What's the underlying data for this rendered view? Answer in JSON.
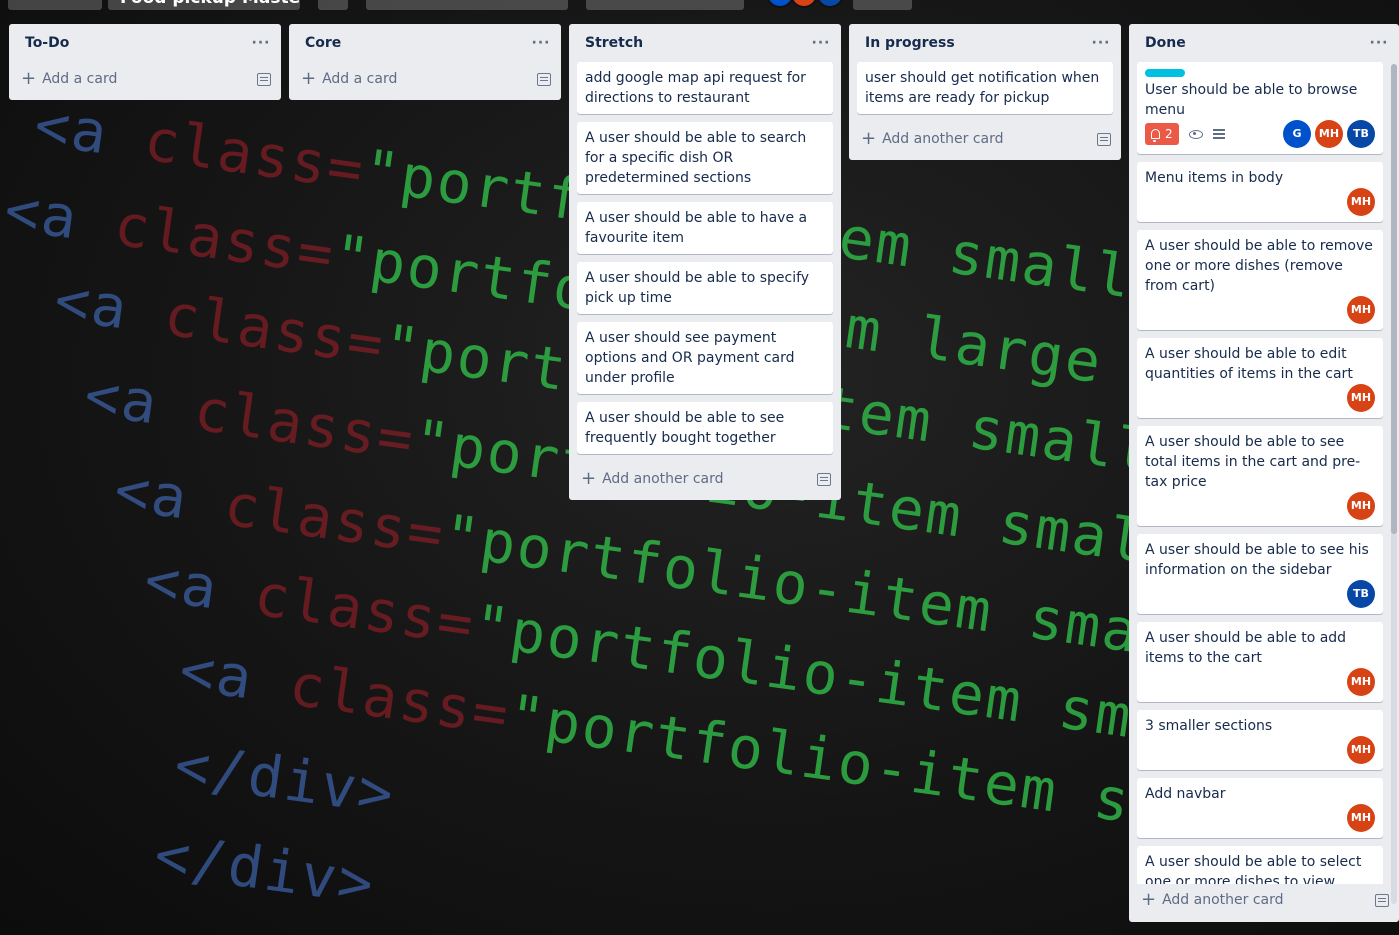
{
  "board": {
    "title": "Food pickup Masterli",
    "background_code_text": "class=\"portfolio-item small picture"
  },
  "colors": {
    "list_bg": "#ebecf0",
    "avatar_mh": "#d84315",
    "avatar_tb": "#0747a6",
    "avatar_g": "#0052cc",
    "label_cyan": "#00c2e0",
    "alert_red": "#eb5a46"
  },
  "lists": {
    "todo": {
      "title": "To-Do",
      "menu": "···",
      "add_label": "Add a card"
    },
    "core": {
      "title": "Core",
      "menu": "···",
      "add_label": "Add a card"
    },
    "stretch": {
      "title": "Stretch",
      "menu": "···",
      "add_label": "Add another card",
      "cards": [
        "add google map api request for directions to restaurant",
        "A user should be able to search for a specific dish OR predetermined sections",
        "A user should be able to have a favourite item",
        "A user should be able to specify pick up time",
        "A user should see payment options and OR payment card under profile",
        "A user should be able to see frequently bought together"
      ]
    },
    "inprogress": {
      "title": "In progress",
      "menu": "···",
      "add_label": "Add another card",
      "cards": [
        "user should get notification when items are ready for pickup"
      ]
    },
    "done": {
      "title": "Done",
      "menu": "···",
      "add_label": "Add another card",
      "first_card": {
        "text": "User should be able to browse menu",
        "alert_count": "2",
        "members": [
          "G",
          "MH",
          "TB"
        ]
      },
      "cards": [
        {
          "text": "Menu items in body",
          "member": "MH"
        },
        {
          "text": "A user should be able to remove one or more dishes (remove from cart)",
          "member": "MH"
        },
        {
          "text": "A user should be able to edit quantities of items in the cart",
          "member": "MH"
        },
        {
          "text": "A user should be able to see total items in the cart and pre-tax price",
          "member": "MH"
        },
        {
          "text": "A user should be able to see his information on the sidebar",
          "member": "TB"
        },
        {
          "text": "A user should be able to add items to the cart",
          "member": "MH"
        },
        {
          "text": "3 smaller sections",
          "member": "MH"
        },
        {
          "text": "Add navbar",
          "member": "MH"
        },
        {
          "text": "A user should be able to select one or more dishes to view more information",
          "member": ""
        }
      ]
    }
  },
  "icons": {
    "menu": "ellipsis-icon",
    "add": "plus-icon",
    "template": "card-template-icon",
    "alert": "bell-icon",
    "watch": "eye-icon",
    "description": "description-icon"
  }
}
